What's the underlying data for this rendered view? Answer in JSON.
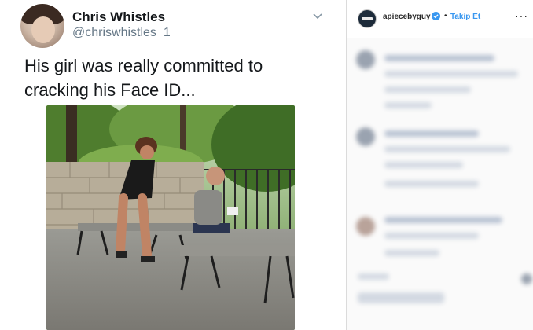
{
  "tweet": {
    "display_name": "Chris Whistles",
    "handle": "@chriswhistles_1",
    "text": "His girl was really committed to cracking his Face ID...",
    "icons": {
      "menu": "chevron-down-icon",
      "avatar": "profile-photo"
    }
  },
  "instagram": {
    "username": "apiecebyguy",
    "separator": "•",
    "follow_label": "Takip Et",
    "more_label": "···",
    "icons": {
      "verified": "verified-badge-icon",
      "more": "more-options-icon"
    }
  },
  "colors": {
    "twitter_text": "#14171a",
    "twitter_secondary": "#657786",
    "instagram_blue": "#3897f0",
    "instagram_text": "#262626"
  }
}
